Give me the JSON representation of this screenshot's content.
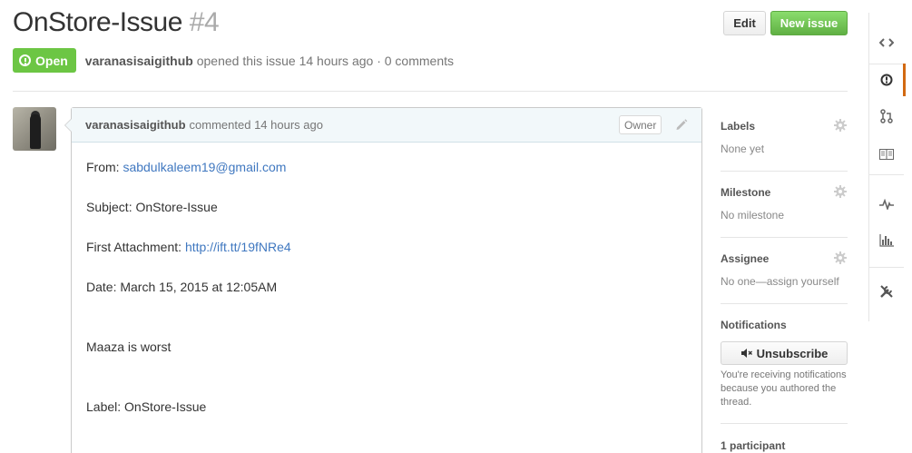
{
  "issue": {
    "title": "OnStore-Issue",
    "number": "#4",
    "state": "Open",
    "author": "varanasisaigithub",
    "opened_text": "opened this issue 14 hours ago · 0 comments"
  },
  "actions": {
    "edit_label": "Edit",
    "new_issue_label": "New issue"
  },
  "comment": {
    "author": "varanasisaigithub",
    "time_text": "commented 14 hours ago",
    "owner_badge": "Owner",
    "from_label": "From: ",
    "from_email": "sabdulkaleem19@gmail.com",
    "subject": "Subject: OnStore-Issue",
    "attachment_label": "First Attachment: ",
    "attachment_link": "http://ift.tt/19fNRe4",
    "date": "Date: March 15, 2015 at 12:05AM",
    "message": "Maaza is worst",
    "label_line": "Label: OnStore-Issue"
  },
  "sidebar": {
    "labels_title": "Labels",
    "labels_value": "None yet",
    "milestone_title": "Milestone",
    "milestone_value": "No milestone",
    "assignee_title": "Assignee",
    "assignee_value": "No one—assign yourself",
    "notifications_title": "Notifications",
    "unsubscribe_label": "Unsubscribe",
    "notifications_note": "You're receiving notifications because you authored the thread.",
    "participants": "1 participant"
  },
  "rail": {
    "items": [
      "code-icon",
      "issues-icon",
      "pull-request-icon",
      "wiki-icon",
      "pulse-icon",
      "graphs-icon",
      "settings-icon"
    ],
    "active": "issues-icon"
  },
  "colors": {
    "open_green": "#6cc644",
    "new_issue_green": "#60b044",
    "link_blue": "#4078c0",
    "active_rail": "#d26911"
  }
}
